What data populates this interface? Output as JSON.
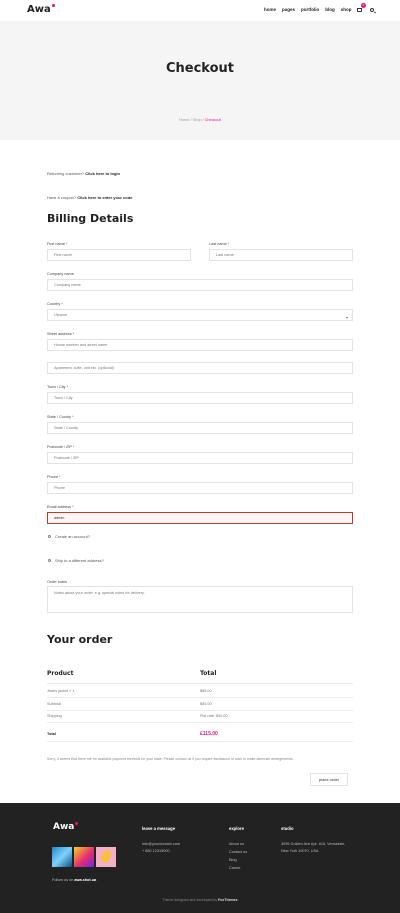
{
  "header": {
    "logo": "Awa",
    "nav": [
      "home",
      "pages",
      "portfolio",
      "blog",
      "shop"
    ],
    "cart_count": "0"
  },
  "hero": {
    "title": "Checkout",
    "breadcrumb": [
      "Home",
      "Shop",
      "Checkout"
    ]
  },
  "notices": {
    "returning_text": "Returning customer?",
    "returning_link": "Click here to login",
    "coupon_text": "Have a coupon?",
    "coupon_link": "Click here to enter your code"
  },
  "billing": {
    "title": "Billing Details",
    "first_name_label": "First name",
    "first_name_placeholder": "First name",
    "last_name_label": "Last name",
    "last_name_placeholder": "Last name",
    "company_label": "Company name",
    "company_placeholder": "Company name",
    "country_label": "Country",
    "country_value": "Ukraine",
    "street_label": "Street address",
    "street_placeholder": "House number and street name",
    "apartment_placeholder": "Apartment, suite, unit etc. (optional)",
    "town_label": "Town / City",
    "town_placeholder": "Town / City",
    "state_label": "State / County",
    "state_placeholder": "State / County",
    "postcode_label": "Postcode / ZIP",
    "postcode_placeholder": "Postcode / ZIP",
    "phone_label": "Phone",
    "phone_placeholder": "Phone",
    "email_label": "Email address",
    "email_value": "admin",
    "create_account": "Create an account?",
    "ship_different": "Ship to a different address?",
    "notes_label": "Order notes",
    "notes_placeholder": "Notes about your order, e.g. special notes for delivery."
  },
  "order": {
    "title": "Your order",
    "col_product": "Product",
    "col_total": "Total",
    "rows": [
      {
        "label": "Jeans jacket  × 1",
        "value": "$85.00"
      },
      {
        "label": "Subtotal",
        "value": "$85.00"
      },
      {
        "label": "Shipping",
        "value": "Flat rate: $30.00"
      }
    ],
    "total_label": "Total",
    "total_value": "£115.00",
    "payment_message": "Sorry, it seems that there are no available payment methods for your state. Please contact us if you require assistance or wish to make alternate arrangements.",
    "place_order": "place order"
  },
  "footer": {
    "logo": "Awa",
    "follow_text": "Follow us on",
    "follow_handle": "awa.shot.ua",
    "message_title": "leave a message",
    "email": "info@yourdomain.com",
    "phone": "+ 880 12315000",
    "explore_title": "explore",
    "explore_links": [
      "About us",
      "Contact us",
      "Blog",
      "Career"
    ],
    "studio_title": "studio",
    "address_line1": "3095 Golden Ave Apt. #16, Vernadale,",
    "address_line2": "New York 10070, USA",
    "copyright_text": "Theme designed and developed by",
    "copyright_brand": "FoxThemes"
  },
  "colors": {
    "accent": "#e6127a",
    "footer_bg": "#222222",
    "hero_bg": "#f5f5f5"
  }
}
